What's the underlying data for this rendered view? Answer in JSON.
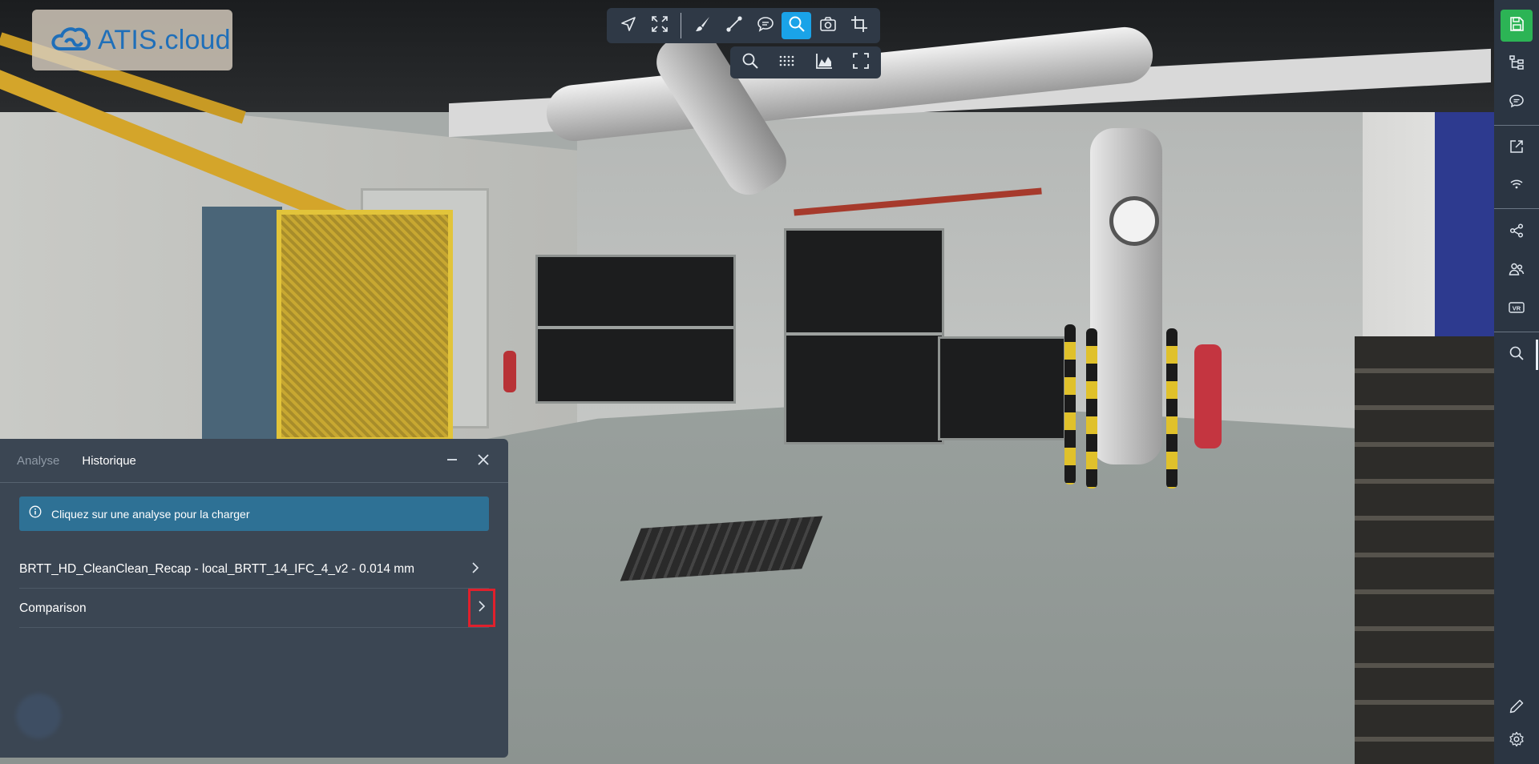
{
  "app": {
    "logo_text": "ATIS.cloud"
  },
  "toolbar": {
    "primary": [
      "navigate",
      "fullscreen-expand",
      "paint",
      "measure",
      "annotation",
      "analysis",
      "camera",
      "crop"
    ],
    "active_tool": "analysis",
    "secondary": [
      "zoom",
      "grid-points",
      "elevation-chart",
      "fit-view"
    ]
  },
  "sidebar": {
    "items": [
      "save",
      "tree",
      "comments",
      "external-link",
      "wifi",
      "share",
      "users",
      "vr",
      "search",
      "edit",
      "settings"
    ],
    "save_color": "#2cb455"
  },
  "panel": {
    "tabs": [
      {
        "label": "Analyse",
        "active": false
      },
      {
        "label": "Historique",
        "active": true
      }
    ],
    "info_message": "Cliquez sur une analyse pour la charger",
    "rows": [
      {
        "label": "BRTT_HD_CleanClean_Recap - local_BRTT_14_IFC_4_v2 - 0.014 mm"
      },
      {
        "label": "Comparison",
        "highlighted": true
      }
    ]
  },
  "colors": {
    "panel_bg": "#3b4653",
    "toolbar_bg": "#2f3946",
    "accent_blue": "#1aa3e8",
    "info_bg": "#2e7195",
    "highlight_red": "#e0202c"
  }
}
